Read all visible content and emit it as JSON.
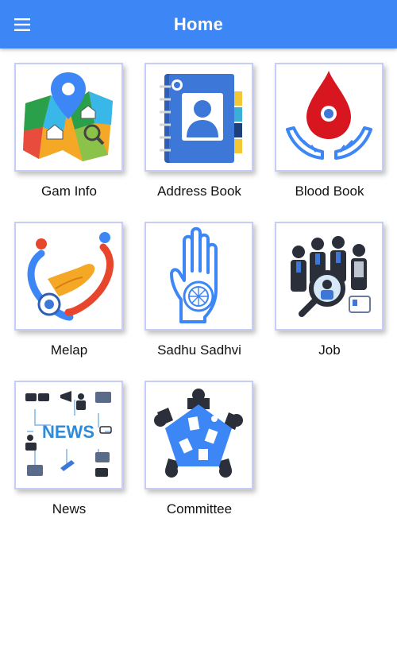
{
  "app_bar": {
    "title": "Home",
    "menu_icon": "hamburger-menu-icon",
    "color": "#3d86f5"
  },
  "tiles": [
    {
      "label": "Gam Info",
      "icon": "map-location-icon"
    },
    {
      "label": "Address Book",
      "icon": "address-book-icon"
    },
    {
      "label": "Blood Book",
      "icon": "blood-drop-hands-icon"
    },
    {
      "label": "Melap",
      "icon": "heart-handshake-icon"
    },
    {
      "label": "Sadhu Sadhvi",
      "icon": "ahimsa-hand-icon"
    },
    {
      "label": "Job",
      "icon": "job-search-icon"
    },
    {
      "label": "News",
      "icon": "news-icon"
    },
    {
      "label": "Committee",
      "icon": "committee-meeting-icon"
    }
  ]
}
